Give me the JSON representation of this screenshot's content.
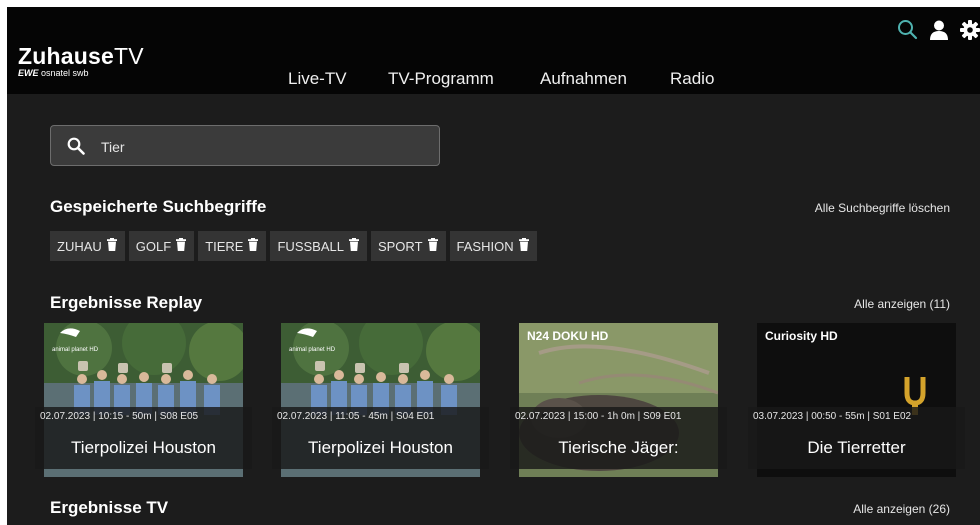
{
  "header": {
    "logo_main": "Zuhause",
    "logo_tv": "TV",
    "logo_sub_ewe": "EWE",
    "logo_sub_rest": "osnatel swb",
    "nav": [
      "Live-TV",
      "TV-Programm",
      "Aufnahmen",
      "Radio"
    ]
  },
  "icons": [
    "search-icon",
    "user-icon",
    "gear-icon"
  ],
  "colors": {
    "accent": "#4fb3b0",
    "background": "#1c1c1c",
    "topbar": "#050505",
    "card_overlay": "#191919"
  },
  "search": {
    "value": "Tier"
  },
  "saved": {
    "title": "Gespeicherte Suchbegriffe",
    "clear_label": "Alle Suchbegriffe löschen",
    "chips": [
      "ZUHAU",
      "GOLF",
      "TIERE",
      "FUSSBALL",
      "SPORT",
      "FASHION"
    ]
  },
  "replay": {
    "title": "Ergebnisse Replay",
    "link": "Alle anzeigen (11)",
    "cards": [
      {
        "channel": "animal planet HD",
        "meta": "02.07.2023 | 10:15 - 50m | S08 E05",
        "title": "Tierpolizei Houston"
      },
      {
        "channel": "animal planet HD",
        "meta": "02.07.2023 | 11:05 - 45m | S04 E01",
        "title": "Tierpolizei Houston"
      },
      {
        "channel": "N24 DOKU HD",
        "meta": "02.07.2023 | 15:00 - 1h 0m | S09 E01",
        "title": "Tierische Jäger:"
      },
      {
        "channel": "Curiosity HD",
        "meta": "03.07.2023 | 00:50 - 55m | S01 E02",
        "title": "Die Tierretter"
      }
    ]
  },
  "tv": {
    "title": "Ergebnisse TV",
    "link": "Alle anzeigen (26)"
  }
}
